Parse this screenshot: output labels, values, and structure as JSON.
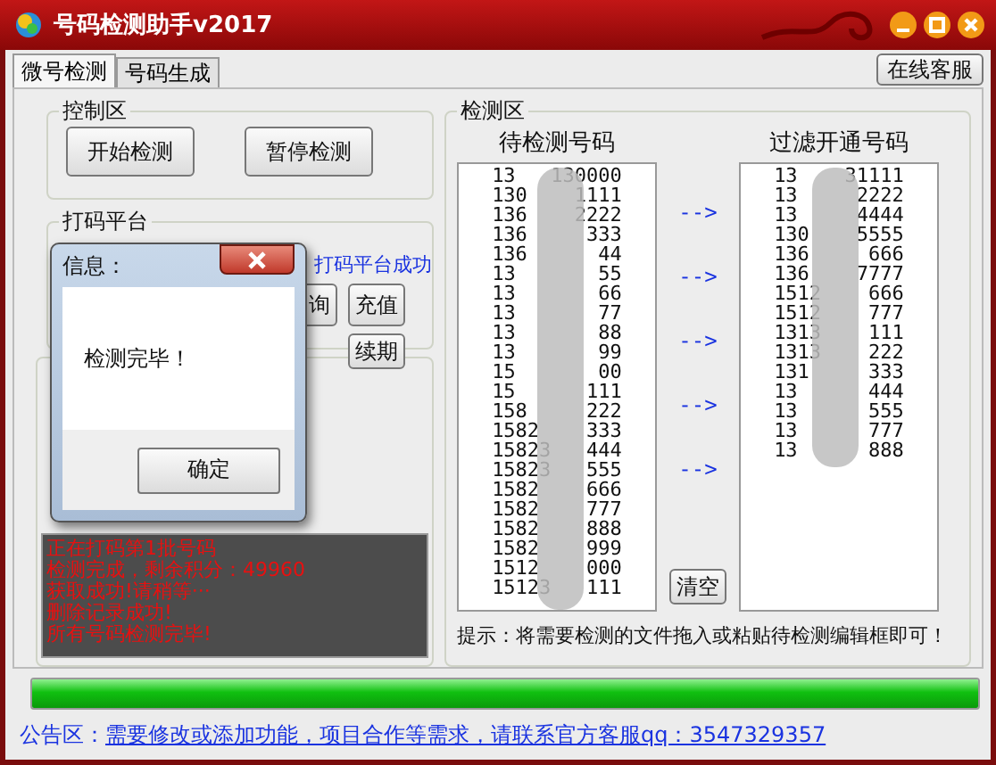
{
  "window": {
    "title": "号码检测助手v2017"
  },
  "tabs": [
    {
      "label": "微号检测",
      "selected": true
    },
    {
      "label": "号码生成",
      "selected": false
    }
  ],
  "service_button": "在线客服",
  "control_area": {
    "title": "控制区",
    "buttons": [
      "开始检测",
      "暂停检测"
    ]
  },
  "captcha_platform": {
    "title": "打码平台",
    "status": "打码平台成功",
    "buttons": [
      "询",
      "充值",
      "续期"
    ]
  },
  "log": [
    "正在打码第1批号码",
    "检测完成，剩余积分：49960",
    "获取成功!请稍等···",
    "删除记录成功!",
    "所有号码检测完毕!"
  ],
  "detect_area": {
    "title": "检测区",
    "pending": {
      "header": "待检测号码",
      "rows": [
        {
          "head": "13",
          "tail": "130000"
        },
        {
          "head": "130",
          "tail": "1111"
        },
        {
          "head": "136",
          "tail": "2222"
        },
        {
          "head": "136",
          "tail": "333"
        },
        {
          "head": "136",
          "tail": "44"
        },
        {
          "head": "13",
          "tail": "55"
        },
        {
          "head": "13",
          "tail": "66"
        },
        {
          "head": "13",
          "tail": "77"
        },
        {
          "head": "13",
          "tail": "88"
        },
        {
          "head": "13",
          "tail": "99"
        },
        {
          "head": "15",
          "tail": "00"
        },
        {
          "head": "15",
          "tail": "111"
        },
        {
          "head": "158",
          "tail": "222"
        },
        {
          "head": "1582",
          "tail": "333"
        },
        {
          "head": "15823",
          "tail": "444"
        },
        {
          "head": "15823",
          "tail": "555"
        },
        {
          "head": "1582",
          "tail": "666"
        },
        {
          "head": "1582",
          "tail": "777"
        },
        {
          "head": "1582",
          "tail": "888"
        },
        {
          "head": "1582",
          "tail": "999"
        },
        {
          "head": "1512",
          "tail": "000"
        },
        {
          "head": "15123",
          "tail": "111"
        }
      ]
    },
    "arrows": [
      "-->",
      "-->",
      "-->",
      "-->",
      "-->"
    ],
    "clear_button": "清空",
    "filtered": {
      "header": "过滤开通号码",
      "rows": [
        {
          "head": "13",
          "tail": "31111"
        },
        {
          "head": "13",
          "tail": "2222"
        },
        {
          "head": "13",
          "tail": "4444"
        },
        {
          "head": "130",
          "tail": "5555"
        },
        {
          "head": "136",
          "tail": "666"
        },
        {
          "head": "136",
          "tail": "7777"
        },
        {
          "head": "1512",
          "tail": "666"
        },
        {
          "head": "1512",
          "tail": "777"
        },
        {
          "head": "1313",
          "tail": "111"
        },
        {
          "head": "1313",
          "tail": "222"
        },
        {
          "head": "131",
          "tail": "333"
        },
        {
          "head": "13",
          "tail": "444"
        },
        {
          "head": "13",
          "tail": "555"
        },
        {
          "head": "13",
          "tail": "777"
        },
        {
          "head": "13",
          "tail": "888"
        }
      ]
    },
    "hint": "提示：将需要检测的文件拖入或粘贴待检测编辑框即可！"
  },
  "progress": {
    "level": 1
  },
  "notice": {
    "label": "公告区：",
    "text": "需要修改或添加功能，项目合作等需求，请联系官方客服qq：3547329357"
  },
  "dialog": {
    "title": "信息：",
    "message": "检测完毕！",
    "button": "确定"
  }
}
